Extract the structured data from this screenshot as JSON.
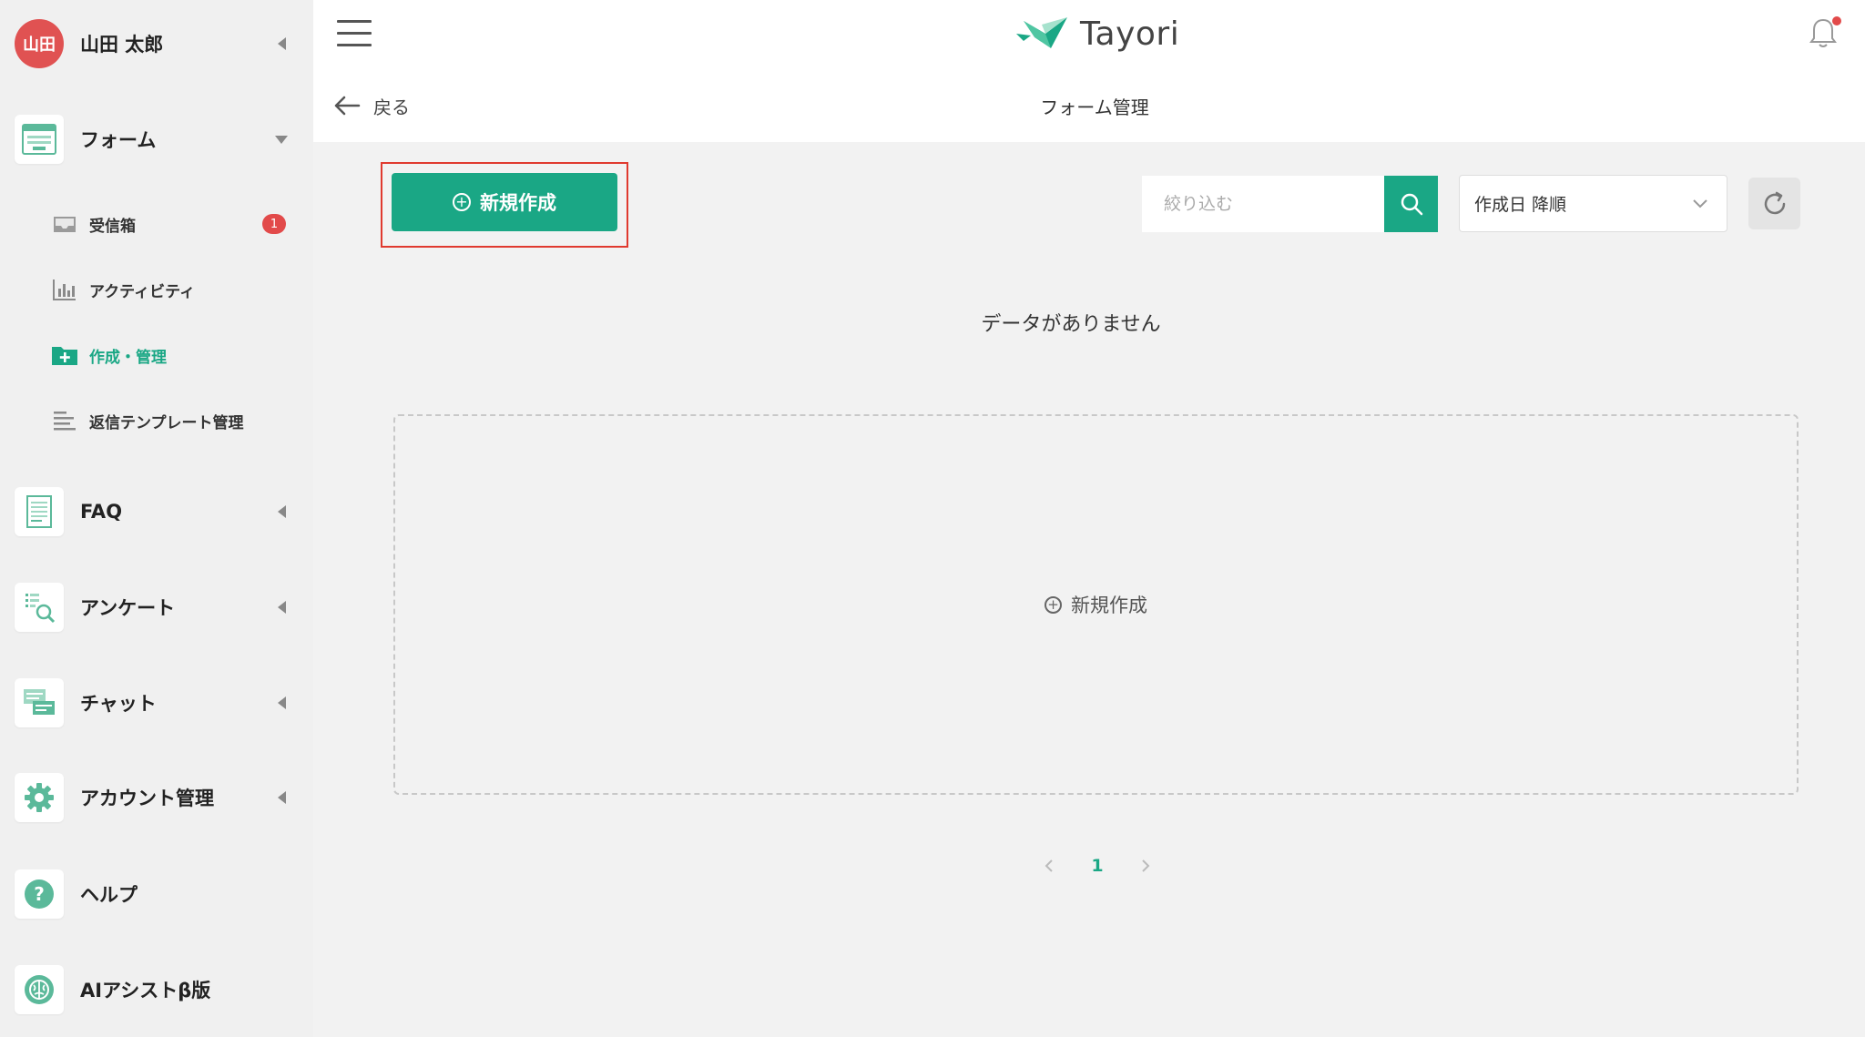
{
  "colors": {
    "accent": "#1aa785",
    "badge": "#e24a4a",
    "avatar": "#e05252",
    "highlight": "#e03a2f"
  },
  "user": {
    "avatar_text": "山田",
    "name": "山田 太郎"
  },
  "sidebar": {
    "form": {
      "label": "フォーム",
      "icon": "form-icon"
    },
    "form_sub": [
      {
        "label": "受信箱",
        "icon": "inbox-icon",
        "badge": "1"
      },
      {
        "label": "アクティビティ",
        "icon": "activity-chart-icon"
      },
      {
        "label": "作成・管理",
        "icon": "folder-plus-icon",
        "active": true
      },
      {
        "label": "返信テンプレート管理",
        "icon": "template-lines-icon"
      }
    ],
    "sections": [
      {
        "label": "FAQ",
        "icon": "faq-document-icon"
      },
      {
        "label": "アンケート",
        "icon": "survey-icon"
      },
      {
        "label": "チャット",
        "icon": "chat-icon"
      },
      {
        "label": "アカウント管理",
        "icon": "gear-icon"
      },
      {
        "label": "ヘルプ",
        "icon": "help-icon"
      },
      {
        "label": "AIアシストβ版",
        "icon": "ai-brain-icon"
      }
    ]
  },
  "header": {
    "logo_text": "Tayori",
    "back_label": "戻る",
    "page_title": "フォーム管理"
  },
  "toolbar": {
    "create_label": "新規作成",
    "search_placeholder": "絞り込む",
    "sort_selected": "作成日 降順"
  },
  "main": {
    "empty_message": "データがありません",
    "dropzone_label": "新規作成"
  },
  "pagination": {
    "current_page": "1"
  }
}
